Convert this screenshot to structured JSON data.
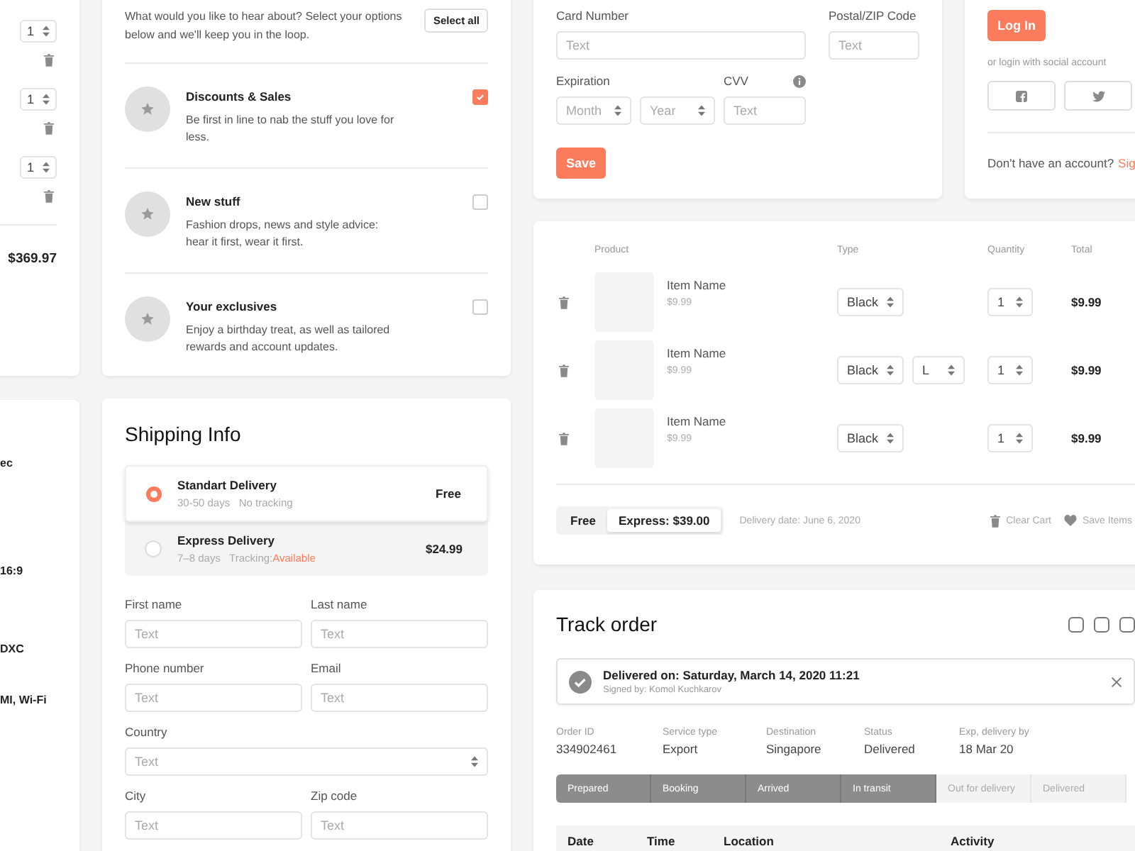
{
  "cart_left": {
    "quantities": [
      "1",
      "1",
      "1"
    ],
    "total": "$369.97"
  },
  "specs": {
    "values": [
      "ec",
      "16:9",
      "DXC",
      "MI, Wi-Fi"
    ]
  },
  "preferences": {
    "intro": "What would you like to hear about? Select your options below and we'll keep you in the loop.",
    "select_all": "Select all",
    "options": [
      {
        "title": "Discounts & Sales",
        "description": "Be first in line to nab the stuff you love for less.",
        "checked": true
      },
      {
        "title": "New stuff",
        "description": "Fashion drops, news and style advice: hear it first, wear it first.",
        "checked": false
      },
      {
        "title": "Your exclusives",
        "description": "Enjoy a birthday treat, as well as tailored rewards and account updates.",
        "checked": false
      }
    ]
  },
  "shipping": {
    "title": "Shipping Info",
    "methods": [
      {
        "name": "Standart Delivery",
        "days": "30-50 days",
        "tracking": "No tracking",
        "price": "Free",
        "selected": true
      },
      {
        "name": "Express Delivery",
        "days": "7–8 days",
        "tracking": "Tracking:",
        "tracking_status": "Available",
        "price": "$24.99",
        "selected": false
      }
    ],
    "field_rows": [
      [
        {
          "label": "First name",
          "kind": "input",
          "placeholder": "Text"
        },
        {
          "label": "Last name",
          "kind": "input",
          "placeholder": "Text"
        }
      ],
      [
        {
          "label": "Phone number",
          "kind": "input",
          "placeholder": "Text"
        },
        {
          "label": "Email",
          "kind": "input",
          "placeholder": "Text"
        }
      ],
      [
        {
          "label": "Country",
          "kind": "select",
          "placeholder": "Text"
        }
      ],
      [
        {
          "label": "City",
          "kind": "input",
          "placeholder": "Text"
        },
        {
          "label": "Zip code",
          "kind": "input",
          "placeholder": "Text"
        }
      ]
    ]
  },
  "payment": {
    "rows": [
      [
        {
          "label": "Card Number",
          "controls": [
            {
              "kind": "input",
              "placeholder": "Text"
            }
          ]
        },
        {
          "label": "Postal/ZIP Code",
          "controls": [
            {
              "kind": "input",
              "placeholder": "Text"
            }
          ]
        }
      ],
      [
        {
          "label": "Expiration",
          "controls": [
            {
              "kind": "select",
              "placeholder": "Month"
            },
            {
              "kind": "select",
              "placeholder": "Year"
            }
          ]
        },
        {
          "label": "CVV",
          "info": true,
          "controls": [
            {
              "kind": "input",
              "placeholder": "Text"
            }
          ]
        }
      ]
    ],
    "button": "Save"
  },
  "login": {
    "button": "Log In",
    "social_hint": "or login with social account",
    "social": [
      {
        "kind": "f"
      },
      {
        "kind": "bird"
      }
    ],
    "prompt": "Don't have an account?",
    "link": "Sig"
  },
  "cart": {
    "columns": [
      "Product",
      "Type",
      "Quantity",
      "Total"
    ],
    "items": [
      {
        "name": "Item Name",
        "price": "$9.99",
        "options": [
          "Black"
        ],
        "quantity": "1",
        "total": "$9.99"
      },
      {
        "name": "Item Name",
        "price": "$9.99",
        "options": [
          "Black",
          "L"
        ],
        "quantity": "1",
        "total": "$9.99"
      },
      {
        "name": "Item Name",
        "price": "$9.99",
        "options": [
          "Black"
        ],
        "quantity": "1",
        "total": "$9.99"
      }
    ],
    "shipping_toggle": [
      {
        "label": "Free",
        "selected": false
      },
      {
        "label": "Express: $39.00",
        "selected": true
      }
    ],
    "delivery_date": "Delivery date: June 6, 2020",
    "actions": [
      {
        "kind": "trash",
        "label": "Clear Cart"
      },
      {
        "kind": "heart",
        "label": "Save Items"
      }
    ]
  },
  "track_order": {
    "title": "Track order",
    "notice": {
      "title": "Delivered on: Saturday, March 14, 2020 11:21",
      "subtitle": "Signed by: Komol Kuchkarov"
    },
    "details": [
      {
        "label": "Order ID",
        "value": "334902461"
      },
      {
        "label": "Service type",
        "value": "Export"
      },
      {
        "label": "Destination",
        "value": "Singapore"
      },
      {
        "label": "Status",
        "value": "Delivered"
      },
      {
        "label": "Exp, delivery by",
        "value": "18 Mar 20"
      }
    ],
    "steps": [
      {
        "label": "Prepared",
        "done": true
      },
      {
        "label": "Booking",
        "done": true
      },
      {
        "label": "Arrived",
        "done": true
      },
      {
        "label": "In transit",
        "done": true
      },
      {
        "label": "Out for delivery",
        "done": false
      },
      {
        "label": "Delivered",
        "done": false
      }
    ],
    "table_columns": [
      "Date",
      "Time",
      "Location",
      "Activity"
    ]
  }
}
